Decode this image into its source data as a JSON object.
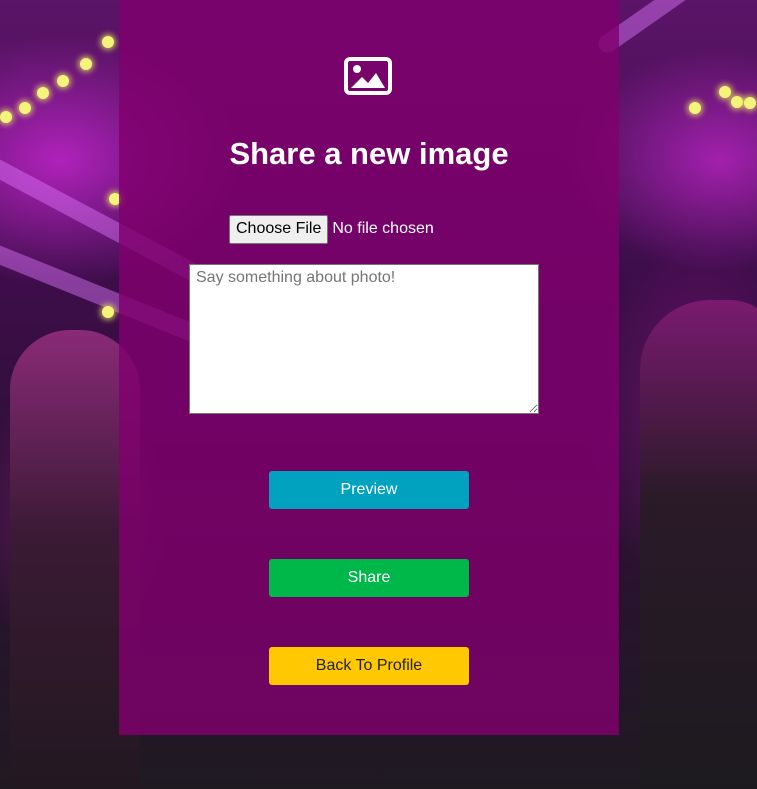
{
  "colors": {
    "panel": "#80006e",
    "preview": "#00a2bf",
    "share": "#00b84a",
    "back": "#ffc800"
  },
  "header": {
    "icon": "image-icon",
    "title": "Share a new image"
  },
  "form": {
    "file": {
      "button_label": "Choose File",
      "status": "No file chosen"
    },
    "caption": {
      "placeholder": "Say something about photo!",
      "value": ""
    },
    "buttons": {
      "preview": "Preview",
      "share": "Share",
      "back": "Back To Profile"
    }
  }
}
